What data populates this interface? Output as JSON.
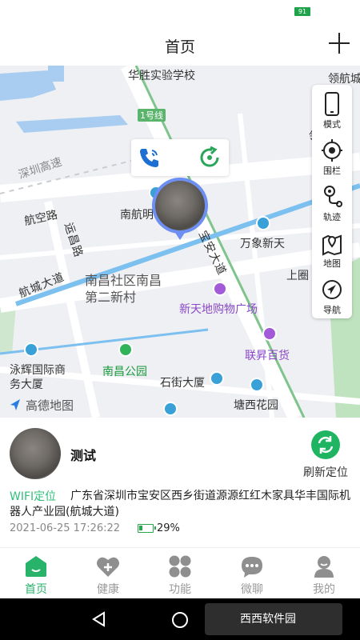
{
  "status_bar": {
    "battery_level": "91"
  },
  "header": {
    "title": "首页"
  },
  "map": {
    "labels": {
      "school": "华胜实验学校",
      "top_right": "领航城",
      "metro": "1号线",
      "highway": "深圳高速",
      "nanhang": "南航明",
      "hangkong_rd": "航空路",
      "yunchang_rd": "运昌路",
      "hangcheng_ave": "航城大道",
      "baoan_ave": "宝安大道",
      "wanxiang": "万象新天",
      "shangwu": "上圈",
      "nanchang_community": "南昌社区南昌第二新村",
      "xintiandi": "新天地购物广场",
      "lianfu": "联昇百货",
      "yonghui": "泳辉国际商务大厦",
      "nanchang_park": "南昌公园",
      "shijie": "石街大厦",
      "tangxi": "塘西花园",
      "right_edge": "领"
    },
    "logo": "高德地图",
    "toolbar": [
      {
        "label": "模式",
        "icon": "phone-mode-icon"
      },
      {
        "label": "围栏",
        "icon": "fence-target-icon"
      },
      {
        "label": "轨迹",
        "icon": "track-route-icon"
      },
      {
        "label": "地图",
        "icon": "map-pin-icon"
      },
      {
        "label": "导航",
        "icon": "navigation-arrow-icon"
      }
    ]
  },
  "device": {
    "name": "测试",
    "refresh_label": "刷新定位",
    "location_type": "WIFI定位",
    "address": "广东省深圳市宝安区西乡街道源源红红木家具华丰国际机器人产业园(航城大道)",
    "timestamp": "2021-06-25 17:26:22",
    "battery": "29%",
    "battery_fraction": 0.29
  },
  "nav": [
    {
      "label": "首页",
      "icon": "home-icon",
      "active": true
    },
    {
      "label": "健康",
      "icon": "health-heart-icon",
      "active": false
    },
    {
      "label": "功能",
      "icon": "functions-grid-icon",
      "active": false
    },
    {
      "label": "微聊",
      "icon": "chat-bubble-icon",
      "active": false
    },
    {
      "label": "我的",
      "icon": "profile-icon",
      "active": false
    }
  ],
  "watermark": "西西软件园"
}
